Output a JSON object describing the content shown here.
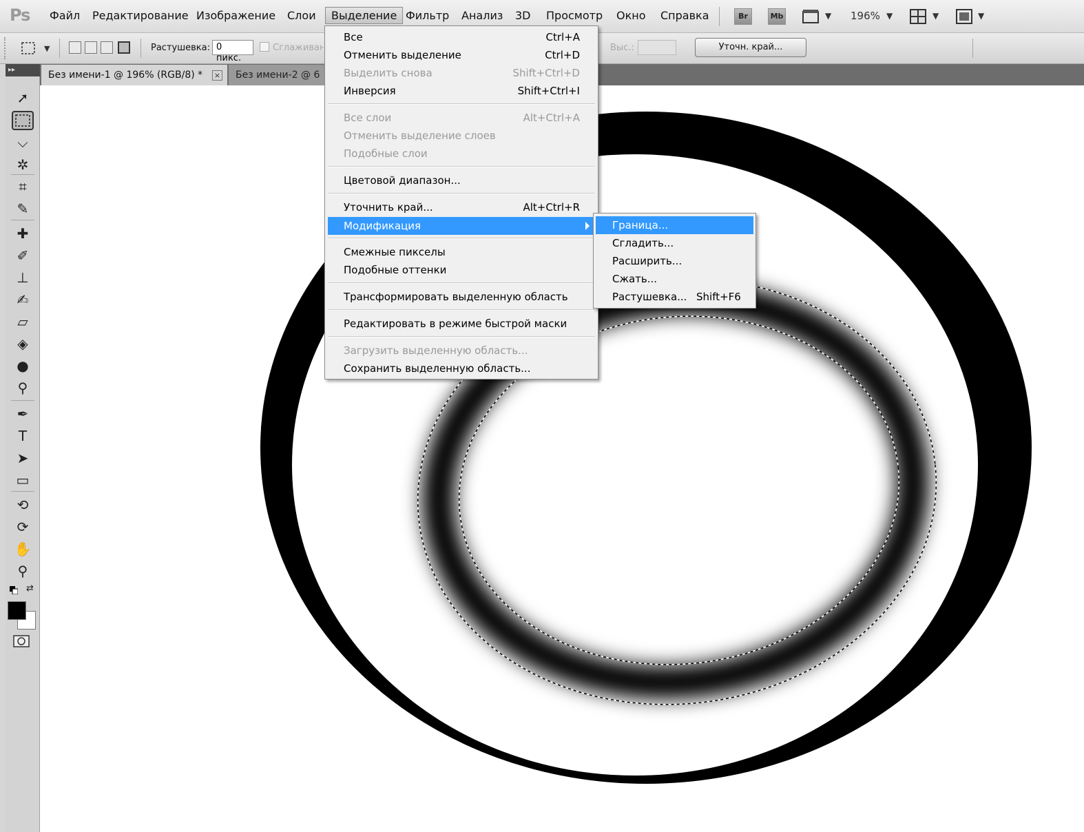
{
  "app": {
    "logo": "Ps"
  },
  "menubar": {
    "items": [
      "Файл",
      "Редактирование",
      "Изображение",
      "Слои",
      "Выделение",
      "Фильтр",
      "Анализ",
      "3D",
      "Просмотр",
      "Окно",
      "Справка"
    ],
    "bridge_label": "Br",
    "minibridge_label": "Mb",
    "zoom": "196%"
  },
  "options": {
    "feather_label": "Растушевка:",
    "feather_value": "0 пикс.",
    "antialias_label": "Сглаживание",
    "height_label": "Выс.:",
    "refine_edge_button": "Уточн. край..."
  },
  "tabs": [
    {
      "label": "Без имени-1 @ 196% (RGB/8) *",
      "close": "×"
    },
    {
      "label": "Без имени-2 @ 6"
    }
  ],
  "select_menu": {
    "groups": [
      [
        {
          "label": "Все",
          "shortcut": "Ctrl+A",
          "disabled": false
        },
        {
          "label": "Отменить выделение",
          "shortcut": "Ctrl+D",
          "disabled": false
        },
        {
          "label": "Выделить снова",
          "shortcut": "Shift+Ctrl+D",
          "disabled": true
        },
        {
          "label": "Инверсия",
          "shortcut": "Shift+Ctrl+I",
          "disabled": false
        }
      ],
      [
        {
          "label": "Все слои",
          "shortcut": "Alt+Ctrl+A",
          "disabled": true
        },
        {
          "label": "Отменить выделение слоев",
          "shortcut": "",
          "disabled": true
        },
        {
          "label": "Подобные слои",
          "shortcut": "",
          "disabled": true
        }
      ],
      [
        {
          "label": "Цветовой диапазон...",
          "shortcut": "",
          "disabled": false
        }
      ],
      [
        {
          "label": "Уточнить край...",
          "shortcut": "Alt+Ctrl+R",
          "disabled": false
        },
        {
          "label": "Модификация",
          "shortcut": "",
          "disabled": false,
          "highlighted": true,
          "submenu": true
        }
      ],
      [
        {
          "label": "Смежные пикселы",
          "shortcut": "",
          "disabled": false
        },
        {
          "label": "Подобные оттенки",
          "shortcut": "",
          "disabled": false
        }
      ],
      [
        {
          "label": "Трансформировать выделенную область",
          "shortcut": "",
          "disabled": false
        }
      ],
      [
        {
          "label": "Редактировать в режиме быстрой маски",
          "shortcut": "",
          "disabled": false
        }
      ],
      [
        {
          "label": "Загрузить выделенную область...",
          "shortcut": "",
          "disabled": true
        },
        {
          "label": "Сохранить выделенную область...",
          "shortcut": "",
          "disabled": false
        }
      ]
    ]
  },
  "modify_submenu": {
    "items": [
      {
        "label": "Граница...",
        "shortcut": "",
        "highlighted": true
      },
      {
        "label": "Сгладить...",
        "shortcut": ""
      },
      {
        "label": "Расширить...",
        "shortcut": ""
      },
      {
        "label": "Сжать...",
        "shortcut": ""
      },
      {
        "label": "Растушевка...",
        "shortcut": "Shift+F6"
      }
    ]
  },
  "colors": {
    "menu_highlight": "#3399ff",
    "foreground": "#000000",
    "background": "#ffffff"
  },
  "tools": [
    "move-tool-icon",
    "rectangular-marquee-icon",
    "polygonal-lasso-icon",
    "quick-selection-icon",
    "crop-icon",
    "eyedropper-icon",
    "spot-healing-icon",
    "brush-icon",
    "clone-stamp-icon",
    "history-brush-icon",
    "eraser-icon",
    "paint-bucket-icon",
    "blur-icon",
    "dodge-icon",
    "pen-icon",
    "type-icon",
    "path-selection-icon",
    "rectangle-shape-icon",
    "3d-rotate-icon",
    "3d-orbit-icon",
    "hand-icon",
    "zoom-icon"
  ]
}
